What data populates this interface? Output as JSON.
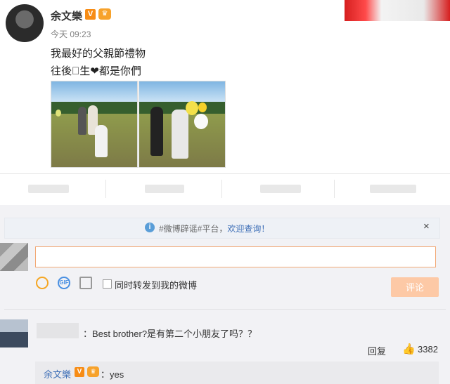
{
  "post": {
    "author": "余文樂",
    "verified_badge": "V",
    "time": "今天 09:23",
    "lines": [
      "我最好的父親節禮物",
      "往後𠍕生❤都是你們"
    ],
    "photos": [
      "photo-kid-with-father",
      "photo-family-with-balloons"
    ]
  },
  "notice": {
    "prefix": "#微博辟谣#平台，",
    "link": "欢迎查询！",
    "close": "×"
  },
  "compose": {
    "placeholder": "",
    "gif_label": "GIF",
    "repost_label": "同时转发到我的微博",
    "submit_label": "评论"
  },
  "comment": {
    "text": "：Best brother?是有第二个小朋友了吗？？",
    "reply_label": "回复",
    "like_count": "3382",
    "reply": {
      "author": "余文樂",
      "text": "：yes"
    }
  },
  "colors": {
    "accent_orange": "#f78c15",
    "link_blue": "#3e6fb7",
    "submit_disabled": "#fdc9a6"
  },
  "icons": [
    "info-icon",
    "close-icon",
    "smile-icon",
    "gif-icon",
    "image-icon",
    "thumb-up-icon",
    "crown-icon",
    "verified-icon"
  ]
}
